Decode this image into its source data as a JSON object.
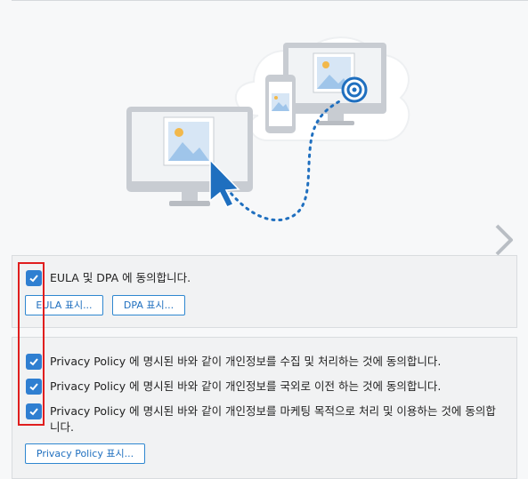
{
  "eula": {
    "checkbox_checked": true,
    "label": "EULA 및 DPA 에 동의합니다.",
    "eula_button": "EULA 표시...",
    "dpa_button": "DPA 표시..."
  },
  "privacy": {
    "items": [
      {
        "checked": true,
        "label": "Privacy Policy 에 명시된 바와 같이 개인정보를 수집 및 처리하는 것에 동의합니다."
      },
      {
        "checked": true,
        "label": "Privacy Policy 에 명시된 바와 같이 개인정보를 국외로 이전 하는 것에 동의합니다."
      },
      {
        "checked": true,
        "label": "Privacy Policy 에 명시된 바와 같이 개인정보를 마케팅 목적으로 처리 및 이용하는 것에 동의합니다."
      }
    ],
    "button": "Privacy Policy 표시..."
  },
  "colors": {
    "accent": "#2f7fd1",
    "highlight": "#e01e1e",
    "monitor": "#c8ccd2"
  },
  "icons": {
    "checkbox": "checkmark-icon",
    "next": "chevron-right-icon",
    "pointer": "cursor-arrow-icon",
    "target": "target-icon"
  }
}
